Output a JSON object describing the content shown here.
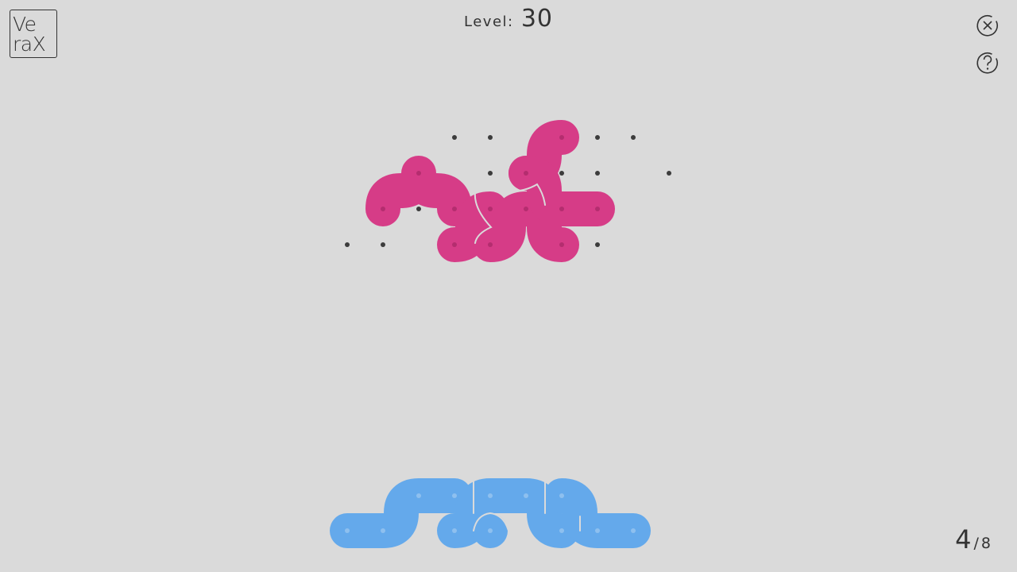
{
  "app": {
    "logo_line1": "Ve",
    "logo_line2": "raX"
  },
  "header": {
    "level_label": "Level:",
    "level_number": "30"
  },
  "controls": {
    "close_icon": "close-icon",
    "help_icon": "help-icon"
  },
  "progress": {
    "current": "4",
    "separator": "/",
    "total": "8"
  },
  "colors": {
    "background": "#dadada",
    "target_piece": "#d63c87",
    "active_piece": "#64a9eb",
    "grid_dot": "#3c3c3c"
  }
}
